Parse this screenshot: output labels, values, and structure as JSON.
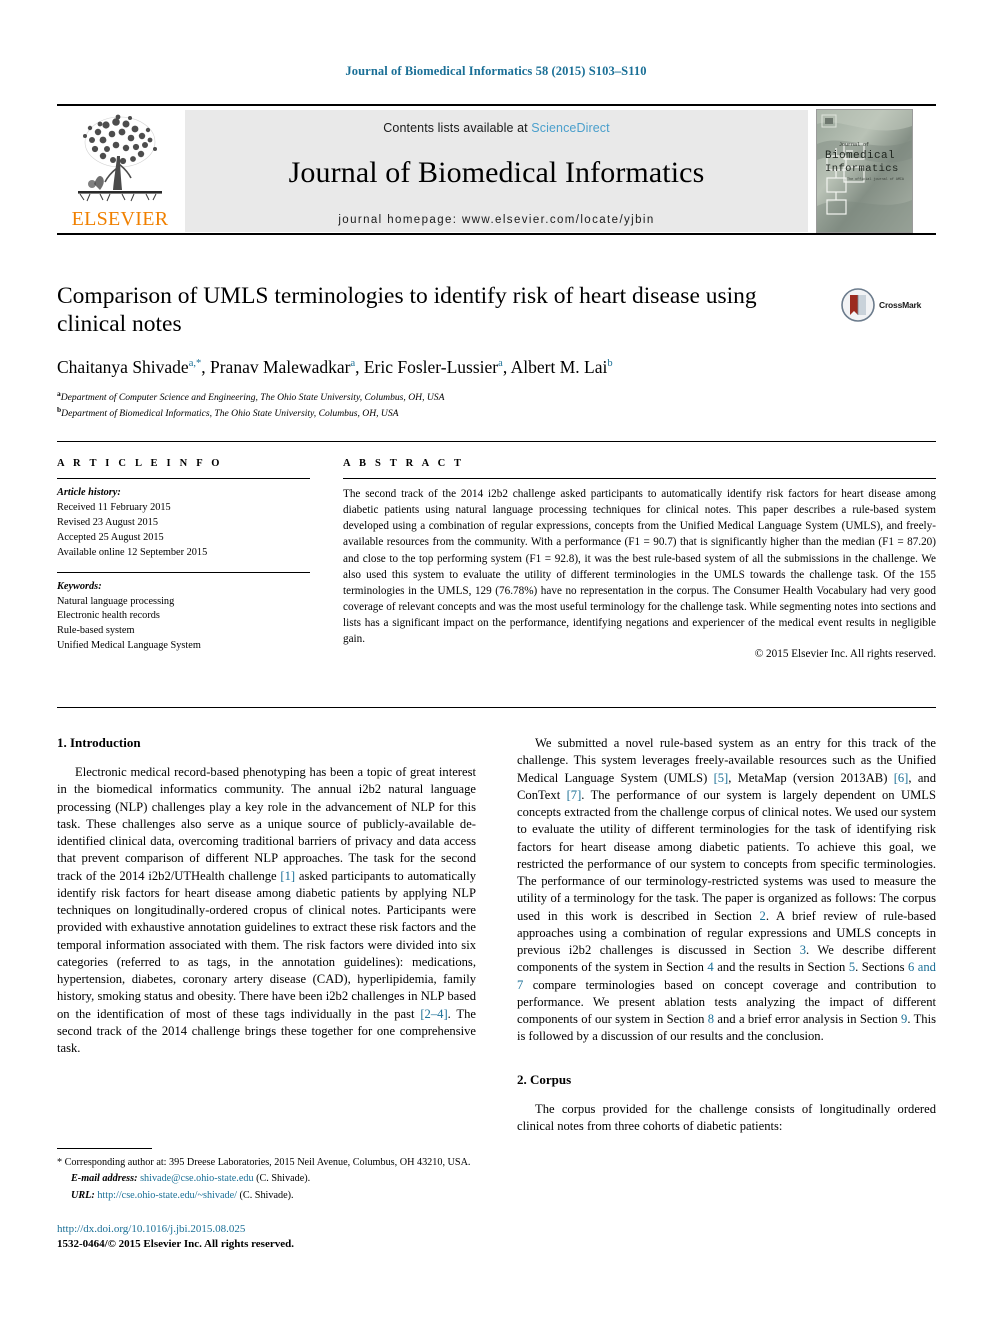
{
  "running_head": "Journal of Biomedical Informatics 58 (2015) S103–S110",
  "masthead": {
    "publisher_name": "ELSEVIER",
    "contents_prefix": "Contents lists available at ",
    "sciencedirect": "ScienceDirect",
    "journal_title": "Journal of Biomedical Informatics",
    "homepage": "journal homepage: www.elsevier.com/locate/yjbin",
    "cover_title_line1": "Journal of",
    "cover_title_line2": "Biomedical",
    "cover_title_line3": "Informatics"
  },
  "article": {
    "title": "Comparison of UMLS terminologies to identify risk of heart disease using clinical notes",
    "crossmark_label": "CrossMark",
    "authors": [
      {
        "name": "Chaitanya Shivade",
        "marks": "a,*"
      },
      {
        "name": "Pranav Malewadkar",
        "marks": "a"
      },
      {
        "name": "Eric Fosler-Lussier",
        "marks": "a"
      },
      {
        "name": "Albert M. Lai",
        "marks": "b"
      }
    ],
    "affiliations": [
      {
        "mark": "a",
        "text": "Department of Computer Science and Engineering, The Ohio State University, Columbus, OH, USA"
      },
      {
        "mark": "b",
        "text": "Department of Biomedical Informatics, The Ohio State University, Columbus, OH, USA"
      }
    ]
  },
  "article_info": {
    "heading": "A R T I C L E   I N F O",
    "history_label": "Article history:",
    "history": [
      "Received 11 February 2015",
      "Revised 23 August 2015",
      "Accepted 25 August 2015",
      "Available online 12 September 2015"
    ],
    "keywords_label": "Keywords:",
    "keywords": [
      "Natural language processing",
      "Electronic health records",
      "Rule-based system",
      "Unified Medical Language System"
    ]
  },
  "abstract": {
    "heading": "A B S T R A C T",
    "text": "The second track of the 2014 i2b2 challenge asked participants to automatically identify risk factors for heart disease among diabetic patients using natural language processing techniques for clinical notes. This paper describes a rule-based system developed using a combination of regular expressions, concepts from the Unified Medical Language System (UMLS), and freely-available resources from the community. With a performance (F1 = 90.7) that is significantly higher than the median (F1 = 87.20) and close to the top performing system (F1 = 92.8), it was the best rule-based system of all the submissions in the challenge. We also used this system to evaluate the utility of different terminologies in the UMLS towards the challenge task. Of the 155 terminologies in the UMLS, 129 (76.78%) have no representation in the corpus. The Consumer Health Vocabulary had very good coverage of relevant concepts and was the most useful terminology for the challenge task. While segmenting notes into sections and lists has a significant impact on the performance, identifying negations and experiencer of the medical event results in negligible gain.",
    "copyright": "© 2015 Elsevier Inc. All rights reserved."
  },
  "sections": {
    "introduction_heading": "1. Introduction",
    "introduction_p1_a": "Electronic medical record-based phenotyping has been a topic of great interest in the biomedical informatics community. The annual i2b2 natural language processing (NLP) challenges play a key role in the advancement of NLP for this task. These challenges also serve as a unique source of publicly-available de-identified clinical data, overcoming traditional barriers of privacy and data access that prevent comparison of different NLP approaches. The task for the second track of the 2014 i2b2/UTHealth challenge ",
    "ref1": "[1]",
    "introduction_p1_b": " asked participants to automatically identify risk factors for heart disease among diabetic patients by applying NLP techniques on longitudinally-ordered cropus of clinical notes. Participants were provided with exhaustive annotation guidelines to extract these risk factors and the temporal information associated with them. The risk factors were divided into six categories (referred to as tags, in the annotation guidelines): medications, hypertension, diabetes, coronary artery disease (CAD), hyperlipidemia, family history, smoking status and obesity. There have been i2b2 challenges in NLP based on the identification of most of these tags individually in the past ",
    "ref2_4": "[2–4]",
    "introduction_p1_c": ". The second track of the 2014 challenge brings these together for one comprehensive task.",
    "right_p1_a": "We submitted a novel rule-based system as an entry for this track of the challenge. This system leverages freely-available resources such as the Unified Medical Language System (UMLS) ",
    "ref5": "[5]",
    "right_p1_b": ", MetaMap (version 2013AB) ",
    "ref6": "[6]",
    "right_p1_c": ", and ConText ",
    "ref7": "[7]",
    "right_p1_d": ". The performance of our system is largely dependent on UMLS concepts extracted from the challenge corpus of clinical notes. We used our system to evaluate the utility of different terminologies for the task of identifying risk factors for heart disease among diabetic patients. To achieve this goal, we restricted the performance of our system to concepts from specific terminologies. The performance of our terminology-restricted systems was used to measure the utility of a terminology for the task. The paper is organized as follows: The corpus used in this work is described in Section ",
    "sec2": "2",
    "right_p1_e": ". A brief review of rule-based approaches using a combination of regular expressions and UMLS concepts in previous i2b2 challenges is discussed in Section ",
    "sec3": "3",
    "right_p1_f": ". We describe different components of the system in Section ",
    "sec4": "4",
    "right_p1_g": " and the results in Section ",
    "sec5": "5",
    "right_p1_h": ". Sections ",
    "sec6and7": "6 and 7",
    "right_p1_i": " compare terminologies based on concept coverage and contribution to performance. We present ablation tests analyzing the impact of different components of our system in Section ",
    "sec8": "8",
    "right_p1_j": " and a brief error analysis in Section ",
    "sec9": "9",
    "right_p1_k": ". This is followed by a discussion of our results and the conclusion.",
    "corpus_heading": "2. Corpus",
    "corpus_p1": "The corpus provided for the challenge consists of longitudinally ordered clinical notes from three cohorts of diabetic patients:"
  },
  "footnotes": {
    "corresponding_marker": "*",
    "corresponding_text": " Corresponding author at: 395 Dreese Laboratories, 2015 Neil Avenue, Columbus, OH 43210, USA.",
    "email_label": "E-mail address:",
    "email_value": "shivade@cse.ohio-state.edu",
    "email_attrib": " (C. Shivade).",
    "url_label": "URL:",
    "url_value": "http://cse.ohio-state.edu/~shivade/",
    "url_attrib": " (C. Shivade).",
    "doi": "http://dx.doi.org/10.1016/j.jbi.2015.08.025",
    "issn": "1532-0464/© 2015 Elsevier Inc. All rights reserved."
  },
  "colors": {
    "link_blue": "#1a6f96",
    "sciencedirect_blue": "#4a9fcc",
    "elsevier_orange": "#F08000",
    "masthead_gray": "#e9e9e9",
    "crossmark_red": "#9c2b20"
  }
}
